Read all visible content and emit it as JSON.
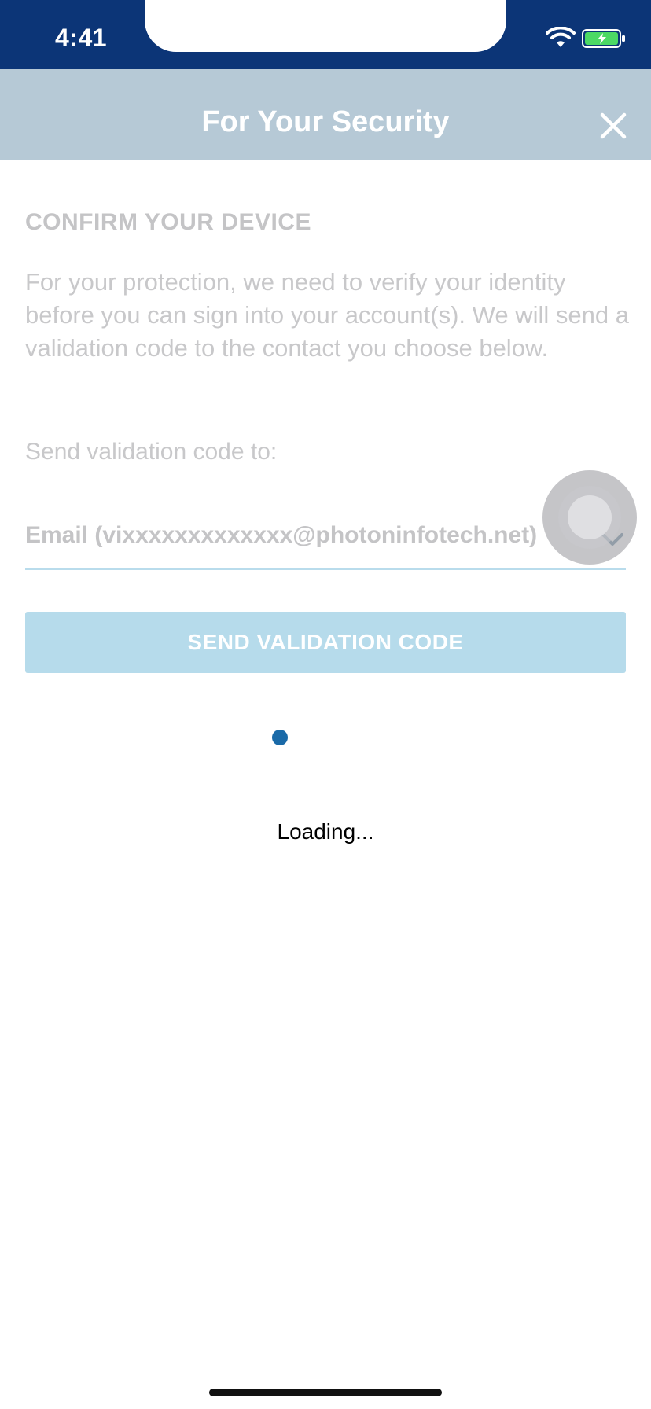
{
  "status_bar": {
    "time": "4:41",
    "wifi_icon": "wifi-icon",
    "battery_icon": "battery-charging-icon",
    "background_color": "#0c3577"
  },
  "header": {
    "title": "For Your Security",
    "close_icon": "close-icon",
    "background_color": "#b6c9d6"
  },
  "content": {
    "heading": "CONFIRM YOUR DEVICE",
    "description": "For your protection, we need to verify your identity before you can sign into your account(s). We will send a validation code to the contact you choose below.",
    "send_to_label": "Send validation code to:",
    "contact_select": {
      "selected_value": "Email (vixxxxxxxxxxxxx@photoninfotech.net)",
      "icon": "chevron-down-icon"
    },
    "send_button_label": "SEND VALIDATION CODE",
    "button_color": "#b6dbeb"
  },
  "loading": {
    "text": "Loading...",
    "spinner_color": "#1a6aa8"
  }
}
